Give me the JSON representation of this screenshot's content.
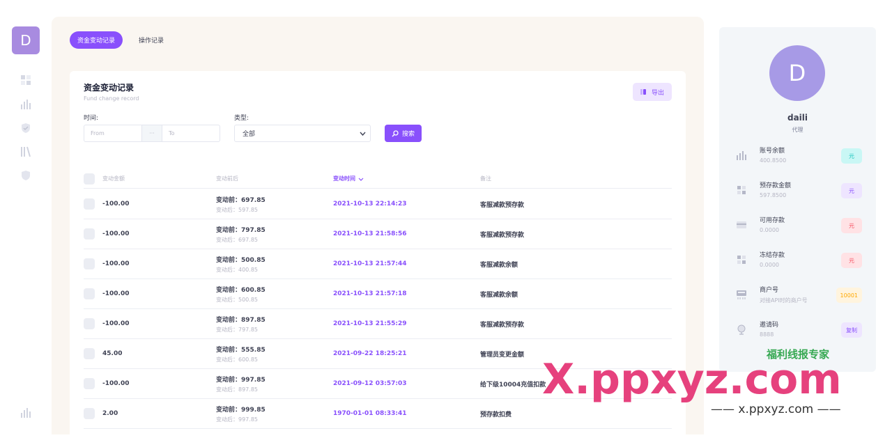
{
  "sidebar": {
    "logo_letter": "D"
  },
  "tabs": [
    {
      "label": "资金变动记录",
      "active": true
    },
    {
      "label": "操作记录",
      "active": false
    }
  ],
  "card": {
    "title": "资金变动记录",
    "subtitle": "Fund change record",
    "export_label": "导出"
  },
  "filters": {
    "time_label": "时间:",
    "from_placeholder": "From",
    "to_placeholder": "To",
    "separator": "···",
    "type_label": "类型:",
    "type_value": "全部",
    "search_label": "搜索"
  },
  "table": {
    "headers": [
      "变动金额",
      "变动前后",
      "变动时间",
      "备注"
    ],
    "before_prefix": "变动前：",
    "after_prefix": "变动后：",
    "rows": [
      {
        "amount": "-100.00",
        "before": "697.85",
        "after": "597.85",
        "time": "2021-10-13 22:14:23",
        "note": "客服减款预存款"
      },
      {
        "amount": "-100.00",
        "before": "797.85",
        "after": "697.85",
        "time": "2021-10-13 21:58:56",
        "note": "客服减款预存款"
      },
      {
        "amount": "-100.00",
        "before": "500.85",
        "after": "400.85",
        "time": "2021-10-13 21:57:44",
        "note": "客服减款余额"
      },
      {
        "amount": "-100.00",
        "before": "600.85",
        "after": "500.85",
        "time": "2021-10-13 21:57:18",
        "note": "客服减款余额"
      },
      {
        "amount": "-100.00",
        "before": "897.85",
        "after": "797.85",
        "time": "2021-10-13 21:55:29",
        "note": "客服减款预存款"
      },
      {
        "amount": "45.00",
        "before": "555.85",
        "after": "600.85",
        "time": "2021-09-22 18:25:21",
        "note": "管理员变更金额"
      },
      {
        "amount": "-100.00",
        "before": "997.85",
        "after": "897.85",
        "time": "2021-09-12 03:57:03",
        "note": "给下级10004充值扣款"
      },
      {
        "amount": "2.00",
        "before": "999.85",
        "after": "997.85",
        "time": "1970-01-01 08:33:41",
        "note": "预存款扣费"
      }
    ]
  },
  "profile": {
    "avatar_letter": "D",
    "name": "daili",
    "role": "代理",
    "stats": [
      {
        "title": "账号余额",
        "value": "400.8500",
        "badge": "元",
        "badge_bg": "#c9f7f5",
        "badge_fg": "#1bc5bd",
        "icon": "bar-chart-icon"
      },
      {
        "title": "预存款金额",
        "value": "597.8500",
        "badge": "元",
        "badge_bg": "#eee5ff",
        "badge_fg": "#8950fc",
        "icon": "grid-icon"
      },
      {
        "title": "可用存款",
        "value": "0.0000",
        "badge": "元",
        "badge_bg": "#ffe2e5",
        "badge_fg": "#f64e60",
        "icon": "card-icon"
      },
      {
        "title": "冻结存款",
        "value": "0.0000",
        "badge": "元",
        "badge_bg": "#ffe2e5",
        "badge_fg": "#f64e60",
        "icon": "grid-icon"
      },
      {
        "title": "商户号",
        "value": "对接API时的商户号",
        "badge": "10001",
        "badge_bg": "#fff4de",
        "badge_fg": "#ffa800",
        "icon": "terminal-icon"
      },
      {
        "title": "邀请码",
        "value": "8888",
        "badge": "复制",
        "badge_bg": "#eee5ff",
        "badge_fg": "#8950fc",
        "icon": "globe-icon"
      }
    ]
  },
  "watermark": {
    "brand": "福利线报专家",
    "big": "X.ppxyz.com",
    "small": "—— x.ppxyz.com ——"
  }
}
